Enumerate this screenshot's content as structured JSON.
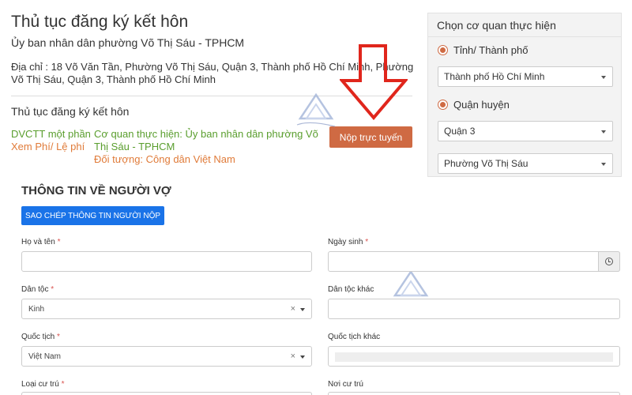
{
  "header": {
    "title": "Thủ tục đăng ký kết hôn",
    "org": "Ủy ban nhân dân phường Võ Thị Sáu - TPHCM",
    "address": "Địa chỉ : 18 Võ Văn Tần, Phường Võ Thị Sáu, Quận 3, Thành phố Hồ Chí Minh, Phường Võ Thị Sáu, Quận 3, Thành phố Hồ Chí Minh"
  },
  "procedure": {
    "title": "Thủ tục đăng ký kết hôn",
    "dvctt_label": "DVCTT một phần",
    "fee_link": "Xem Phí/ Lệ phí",
    "agency": "Cơ quan thực hiện: Ủy ban nhân dân phường Võ Thị Sáu - TPHCM",
    "target": "Đối tượng: Công dân Việt Nam",
    "submit_label": "Nộp trực tuyến"
  },
  "panel": {
    "title": "Chọn cơ quan thực hiện",
    "radio_province": "Tỉnh/ Thành phố",
    "province_value": "Thành phố Hồ Chí Minh",
    "radio_district": "Quận huyện",
    "district_value": "Quận 3",
    "ward_value": "Phường Võ Thị Sáu"
  },
  "form": {
    "title": "THÔNG TIN VỀ NGƯỜI VỢ",
    "copy_button": "SAO CHÉP THÔNG TIN NGƯỜI NỘP",
    "required_mark": "*",
    "full_name_label": "Họ và tên",
    "full_name_value": "",
    "dob_label": "Ngày sinh",
    "dob_value": "",
    "ethnicity_label": "Dân tộc",
    "ethnicity_value": "Kinh",
    "other_ethnicity_label": "Dân tộc khác",
    "nationality_label": "Quốc tịch",
    "nationality_value": "Việt Nam",
    "other_nationality_label": "Quốc tịch khác",
    "residence_type_label": "Loại cư trú",
    "residence_place_label": "Nơi cư trú",
    "clear_symbol": "×"
  },
  "colors": {
    "accent_orange": "#cf6a43",
    "link_green": "#5a9e2e",
    "primary_blue": "#1a73e8",
    "arrow_red": "#e0261c"
  },
  "icons": {
    "arrow": "down-arrow-icon",
    "watermark": "watermark-logo-icon",
    "clock": "clock-icon",
    "caret": "caret-down-icon"
  }
}
